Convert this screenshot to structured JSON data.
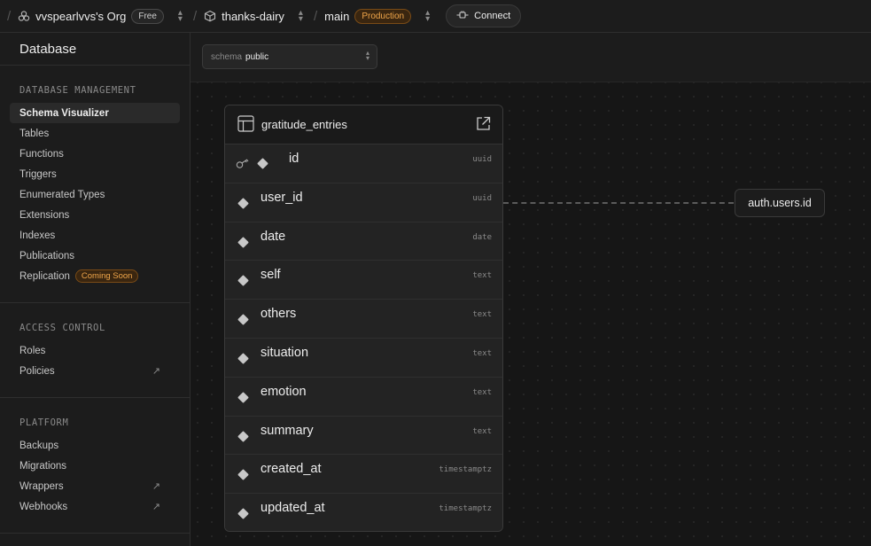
{
  "topbar": {
    "org_name": "vvspearlvvs's Org",
    "org_badge": "Free",
    "project_name": "thanks-dairy",
    "branch_name": "main",
    "branch_badge": "Production",
    "connect_label": "Connect"
  },
  "sidebar": {
    "title": "Database",
    "sections": [
      {
        "heading": "DATABASE MANAGEMENT",
        "items": [
          {
            "label": "Schema Visualizer"
          },
          {
            "label": "Tables"
          },
          {
            "label": "Functions"
          },
          {
            "label": "Triggers"
          },
          {
            "label": "Enumerated Types"
          },
          {
            "label": "Extensions"
          },
          {
            "label": "Indexes"
          },
          {
            "label": "Publications"
          },
          {
            "label": "Replication",
            "badge": "Coming Soon"
          }
        ]
      },
      {
        "heading": "ACCESS CONTROL",
        "items": [
          {
            "label": "Roles"
          },
          {
            "label": "Policies"
          }
        ]
      },
      {
        "heading": "PLATFORM",
        "items": [
          {
            "label": "Backups"
          },
          {
            "label": "Migrations"
          },
          {
            "label": "Wrappers"
          },
          {
            "label": "Webhooks"
          }
        ]
      }
    ]
  },
  "schema_select": {
    "label": "schema",
    "value": "public"
  },
  "table": {
    "name": "gratitude_entries",
    "columns": [
      {
        "name": "id",
        "type": "uuid"
      },
      {
        "name": "user_id",
        "type": "uuid"
      },
      {
        "name": "date",
        "type": "date"
      },
      {
        "name": "self",
        "type": "text"
      },
      {
        "name": "others",
        "type": "text"
      },
      {
        "name": "situation",
        "type": "text"
      },
      {
        "name": "emotion",
        "type": "text"
      },
      {
        "name": "summary",
        "type": "text"
      },
      {
        "name": "created_at",
        "type": "timestamptz"
      },
      {
        "name": "updated_at",
        "type": "timestamptz"
      }
    ]
  },
  "relation": {
    "target": "auth.users.id"
  },
  "colors": {
    "accent_orange": "#f0a64a",
    "background": "#1c1c1c",
    "canvas": "#161616"
  }
}
